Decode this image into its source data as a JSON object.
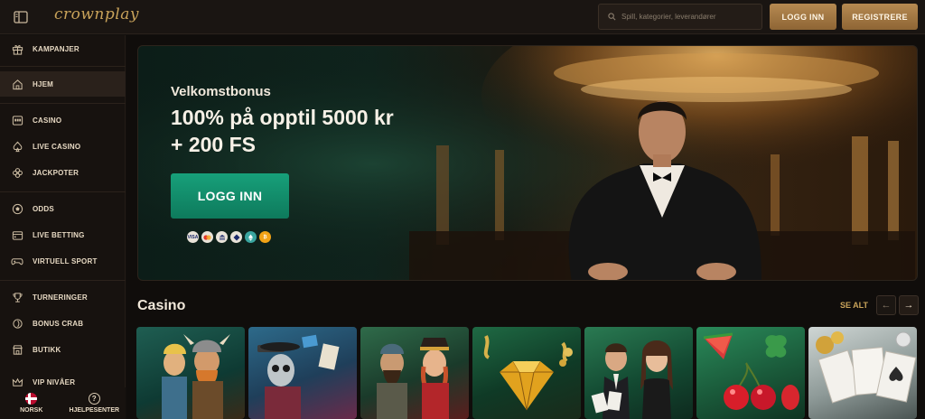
{
  "header": {
    "logo": "crownplay",
    "search_placeholder": "Spill, kategorier, leverandører",
    "login_label": "LOGG INN",
    "register_label": "REGISTRERE"
  },
  "sidebar": {
    "items": [
      {
        "label": "KAMPANJER",
        "icon": "gift-icon"
      },
      {
        "label": "HJEM",
        "icon": "home-icon"
      },
      {
        "label": "CASINO",
        "icon": "slot-machine-icon"
      },
      {
        "label": "LIVE CASINO",
        "icon": "spade-icon"
      },
      {
        "label": "JACKPOTER",
        "icon": "clover-icon"
      },
      {
        "label": "ODDS",
        "icon": "ball-icon"
      },
      {
        "label": "LIVE BETTING",
        "icon": "live-betting-icon"
      },
      {
        "label": "VIRTUELL SPORT",
        "icon": "gamepad-icon"
      },
      {
        "label": "TURNERINGER",
        "icon": "trophy-icon"
      },
      {
        "label": "BONUS CRAB",
        "icon": "crab-icon"
      },
      {
        "label": "BUTIKK",
        "icon": "shop-icon"
      },
      {
        "label": "VIP NIVÅER",
        "icon": "crown-icon"
      }
    ],
    "footer": {
      "language": "NORSK",
      "help": "HJELPESENTER"
    }
  },
  "hero": {
    "subtitle": "Velkomstbonus",
    "title_line1": "100% på opptil 5000 kr",
    "title_line2": "+ 200 FS",
    "button_label": "LOGG INN",
    "payment_methods": [
      "visa-icon",
      "mastercard-icon",
      "bank-icon",
      "crypto-icon",
      "ethereum-icon",
      "bitcoin-icon"
    ]
  },
  "casino_section": {
    "title": "Casino",
    "see_all": "SE ALT",
    "games": [
      {
        "icon": "vikings-game"
      },
      {
        "icon": "skeleton-game"
      },
      {
        "icon": "pirates-game"
      },
      {
        "icon": "diamond-game"
      },
      {
        "icon": "blackjack-game"
      },
      {
        "icon": "fruit-game"
      },
      {
        "icon": "cards-game"
      }
    ]
  },
  "colors": {
    "accent_gold": "#c9a35a",
    "hero_button": "#15946f",
    "background": "#120f0d"
  }
}
